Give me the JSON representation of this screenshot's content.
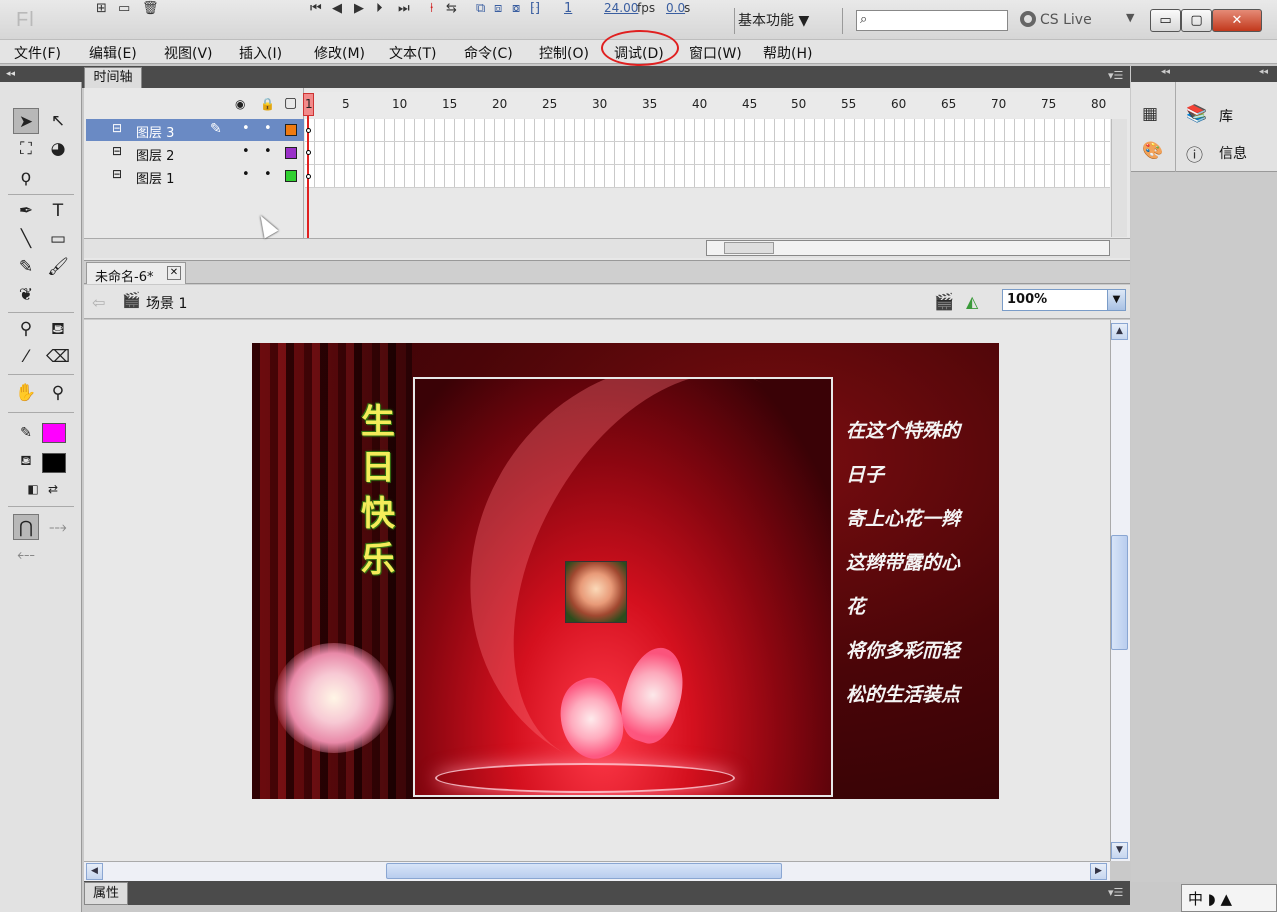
{
  "app": {
    "logo": "Fl",
    "workspace": "基本功能 ▼",
    "search_icon": "search-icon",
    "cs_live": "CS Live",
    "cs_caret": "▼",
    "min": "▭",
    "max": "▢",
    "close": "✕"
  },
  "menu": {
    "items": [
      "文件(F)",
      "编辑(E)",
      "视图(V)",
      "插入(I)",
      "修改(M)",
      "文本(T)",
      "命令(C)",
      "控制(O)",
      "调试(D)",
      "窗口(W)",
      "帮助(H)"
    ],
    "highlighted": "调试(D)",
    "highlight_color": "#e02020"
  },
  "timeline": {
    "tab": "时间轴",
    "menu": "▾☰",
    "header_icons": [
      "eye-icon",
      "lock-icon",
      "outline-icon"
    ],
    "frame_numbers": [
      "1",
      "5",
      "10",
      "15",
      "20",
      "25",
      "30",
      "35",
      "40",
      "45",
      "50",
      "55",
      "60",
      "65",
      "70",
      "75",
      "80"
    ],
    "layers": [
      {
        "name": "图层 3",
        "color": "#f07a10",
        "selected": true
      },
      {
        "name": "图层 2",
        "color": "#9a30c8",
        "selected": false
      },
      {
        "name": "图层 1",
        "color": "#30d030",
        "selected": false
      }
    ],
    "footer": {
      "current_frame": "1",
      "fps": "24.00",
      "fps_unit": "fps",
      "time": "0.0",
      "time_unit": "s"
    }
  },
  "document": {
    "tab": "未命名-6*",
    "close": "✕",
    "scene": "场景 1",
    "zoom": "100%"
  },
  "stage": {
    "title_chars": [
      "生",
      "日",
      "快",
      "乐"
    ],
    "poem_lines": [
      "在这个特殊的",
      "日子",
      "寄上心花一辫",
      "这辫带露的心",
      "花",
      "将你多彩而轻",
      "松的生活装点"
    ]
  },
  "right_panel": {
    "library": "库",
    "info": "信息"
  },
  "properties": {
    "tab": "属性",
    "menu": "▾☰"
  },
  "ime": {
    "label": "中 ◗ ▲"
  },
  "colors": {
    "stroke": "#ff00ff",
    "fill": "#000000"
  }
}
